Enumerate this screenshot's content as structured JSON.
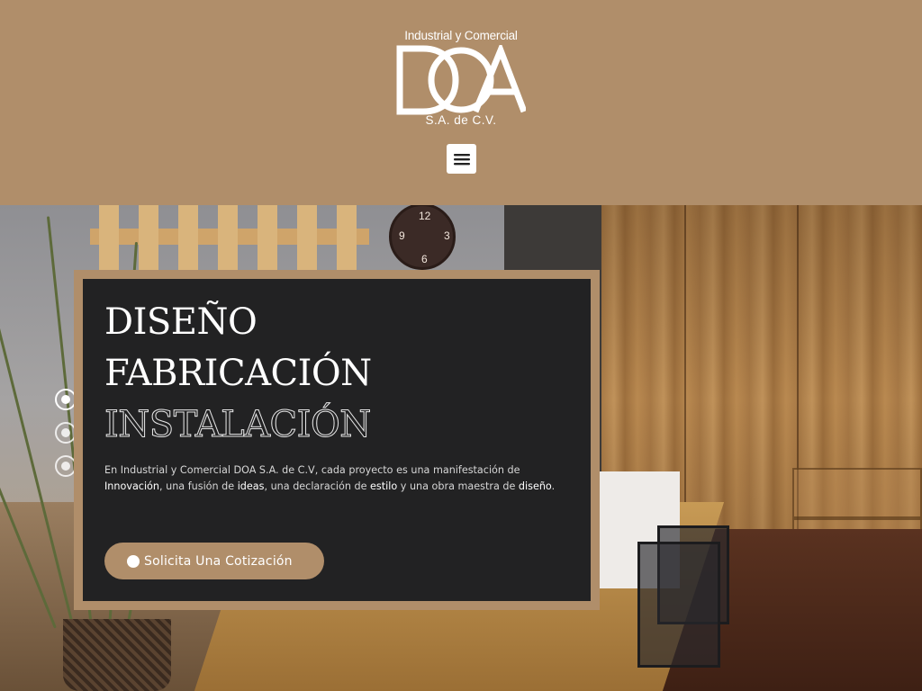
{
  "header": {
    "logo": {
      "top_text": "Industrial y Comercial",
      "mark": "DOA",
      "bottom_text": "S.A. de C.V."
    },
    "menu_icon": "hamburger-icon"
  },
  "hero": {
    "slider_dots": [
      {
        "active": true
      },
      {
        "active": false
      },
      {
        "active": false
      }
    ],
    "headings": [
      "DISEÑO",
      "FABRICACIÓN",
      "INSTALACIÓN"
    ],
    "description": {
      "part1": "En Industrial y Comercial DOA S.A. de C.V, cada proyecto es una manifestación de ",
      "hl1": "Innovación",
      "part2": ", una fusión de ",
      "hl2": "ideas",
      "part3": ", una declaración de ",
      "hl3": "estilo",
      "part4": " y una obra maestra de ",
      "hl4": "diseño",
      "part5": "."
    },
    "cta": {
      "label": "Solicita Una Cotización",
      "icon": "circle-icon"
    }
  },
  "colors": {
    "brand_tan": "#b08e6a",
    "box_dark": "#222223",
    "white": "#ffffff"
  }
}
